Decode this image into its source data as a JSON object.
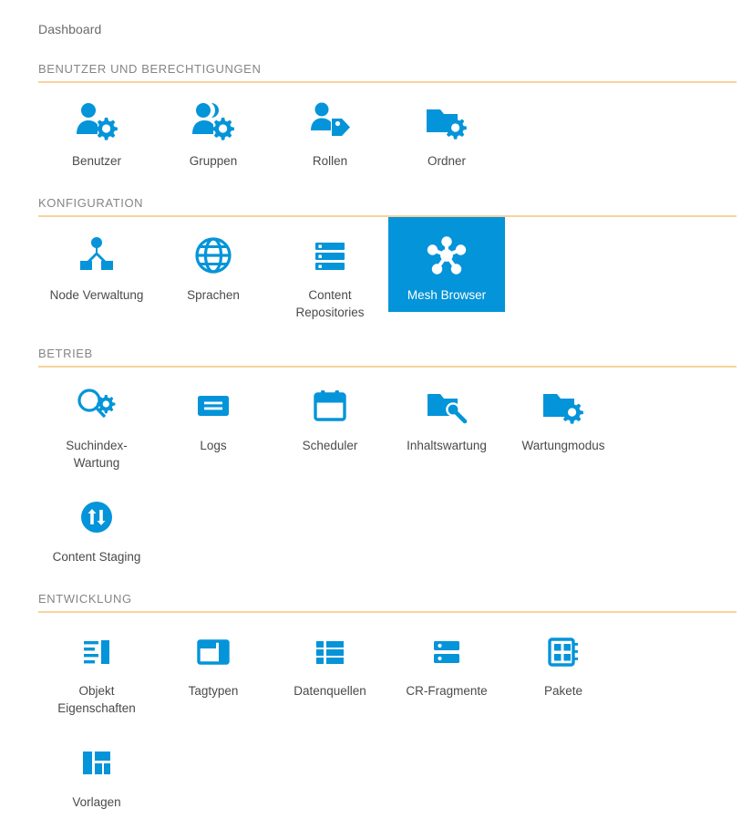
{
  "breadcrumb": {
    "label": "Dashboard"
  },
  "theme": {
    "accent_blue": "#0494d9",
    "rule_orange": "#fad29a",
    "section_header_color": "#858585",
    "label_color": "#4a4a4a",
    "background": "#ffffff"
  },
  "sections": [
    {
      "title": "BENUTZER UND BERECHTIGUNGEN",
      "tiles": [
        {
          "label": "Benutzer",
          "icon": "user-gear-icon",
          "selected": false
        },
        {
          "label": "Gruppen",
          "icon": "users-gear-icon",
          "selected": false
        },
        {
          "label": "Rollen",
          "icon": "user-tag-icon",
          "selected": false
        },
        {
          "label": "Ordner",
          "icon": "folder-gear-icon",
          "selected": false
        }
      ]
    },
    {
      "title": "KONFIGURATION",
      "tiles": [
        {
          "label": "Node Verwaltung",
          "icon": "node-hierarchy-icon",
          "selected": false
        },
        {
          "label": "Sprachen",
          "icon": "globe-icon",
          "selected": false
        },
        {
          "label": "Content\nRepositories",
          "icon": "server-list-icon",
          "selected": false
        },
        {
          "label": "Mesh Browser",
          "icon": "mesh-network-icon",
          "selected": true
        }
      ]
    },
    {
      "title": "BETRIEB",
      "tiles": [
        {
          "label": "Suchindex-\nWartung",
          "icon": "search-gear-icon",
          "selected": false
        },
        {
          "label": "Logs",
          "icon": "log-lines-icon",
          "selected": false
        },
        {
          "label": "Scheduler",
          "icon": "calendar-icon",
          "selected": false
        },
        {
          "label": "Inhaltswartung",
          "icon": "folder-wrench-icon",
          "selected": false
        },
        {
          "label": "Wartungmodus",
          "icon": "folder-gear-icon",
          "selected": false
        },
        {
          "label": "Content Staging",
          "icon": "sync-arrows-circle-icon",
          "selected": false
        }
      ]
    },
    {
      "title": "ENTWICKLUNG",
      "tiles": [
        {
          "label": "Objekt\nEigenschaften",
          "icon": "object-properties-icon",
          "selected": false
        },
        {
          "label": "Tagtypen",
          "icon": "tag-layout-icon",
          "selected": false
        },
        {
          "label": "Datenquellen",
          "icon": "datasource-grid-icon",
          "selected": false
        },
        {
          "label": "CR-Fragmente",
          "icon": "cr-fragment-icon",
          "selected": false
        },
        {
          "label": "Pakete",
          "icon": "package-icon",
          "selected": false
        },
        {
          "label": "Vorlagen",
          "icon": "templates-icon",
          "selected": false
        }
      ]
    }
  ]
}
